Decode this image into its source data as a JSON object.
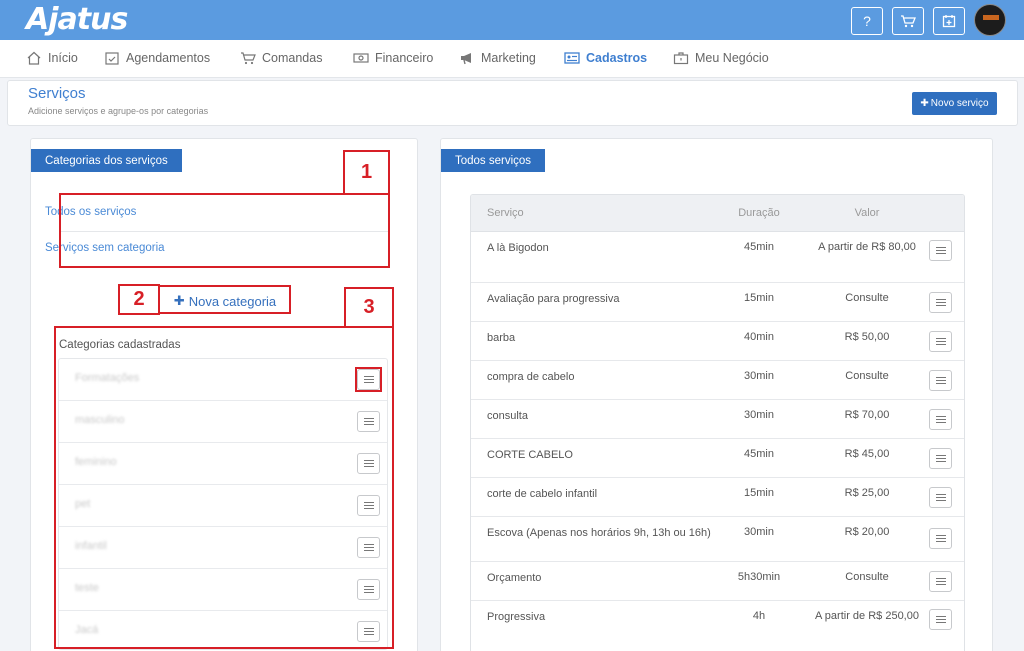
{
  "app": {
    "logo": "Ajatus"
  },
  "topbar": {
    "help_label": "?",
    "colors": {
      "bar": "#5b9be0",
      "accent": "#2f6fbf"
    }
  },
  "nav": {
    "items": [
      {
        "label": "Início",
        "icon": "home-icon"
      },
      {
        "label": "Agendamentos",
        "icon": "calendar-check-icon"
      },
      {
        "label": "Comandas",
        "icon": "cart-icon"
      },
      {
        "label": "Financeiro",
        "icon": "money-icon"
      },
      {
        "label": "Marketing",
        "icon": "megaphone-icon"
      },
      {
        "label": "Cadastros",
        "icon": "id-card-icon",
        "active": true
      },
      {
        "label": "Meu Negócio",
        "icon": "briefcase-icon"
      }
    ]
  },
  "header": {
    "title": "Serviços",
    "subtitle": "Adicione serviços e agrupe-os por categorias",
    "new_service_label": "Novo serviço"
  },
  "categories_panel": {
    "tab_label": "Categorias dos serviços",
    "links": [
      "Todos os serviços",
      "Serviços sem categoria"
    ],
    "new_category_label": "Nova categoria",
    "registered_title": "Categorias cadastradas",
    "registered": [
      "Formatações",
      "masculino",
      "feminino",
      "pet",
      "infantil",
      "teste",
      "Jacá"
    ]
  },
  "services_panel": {
    "tab_label": "Todos serviços",
    "columns": [
      "Serviço",
      "Duração",
      "Valor"
    ],
    "rows": [
      {
        "name": "A là Bigodon",
        "duration": "45min",
        "value": "A partir de R$ 80,00"
      },
      {
        "name": "Avaliação para progressiva",
        "duration": "15min",
        "value": "Consulte"
      },
      {
        "name": "barba",
        "duration": "40min",
        "value": "R$ 50,00"
      },
      {
        "name": "compra de cabelo",
        "duration": "30min",
        "value": "Consulte"
      },
      {
        "name": "consulta",
        "duration": "30min",
        "value": "R$ 70,00"
      },
      {
        "name": "CORTE CABELO",
        "duration": "45min",
        "value": "R$ 45,00"
      },
      {
        "name": "corte de cabelo infantil",
        "duration": "15min",
        "value": "R$ 25,00"
      },
      {
        "name": "Escova (Apenas nos horários 9h, 13h ou 16h)",
        "duration": "30min",
        "value": "R$ 20,00"
      },
      {
        "name": "Orçamento",
        "duration": "5h30min",
        "value": "Consulte"
      },
      {
        "name": "Progressiva",
        "duration": "4h",
        "value": "A partir de R$ 250,00"
      }
    ]
  },
  "annotations": {
    "labels": [
      "1",
      "2",
      "3"
    ],
    "color": "#d71f26"
  }
}
